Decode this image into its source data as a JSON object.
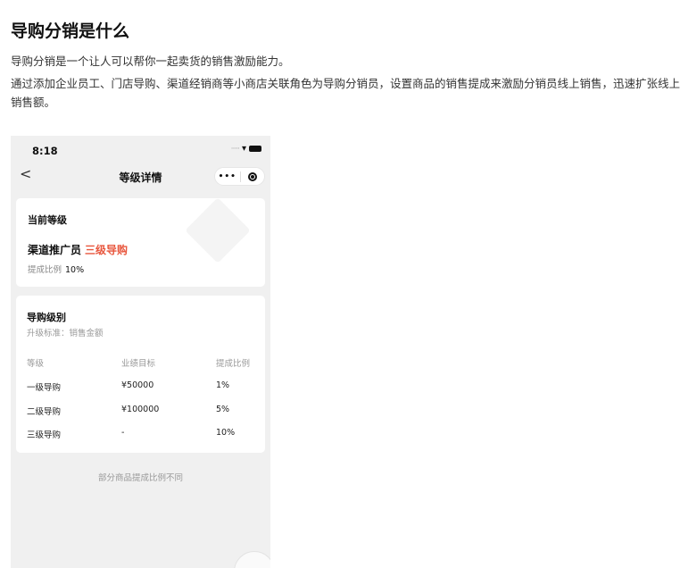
{
  "doc": {
    "title": "导购分销是什么",
    "paragraph1": "导购分销是一个让人可以帮你一起卖货的销售激励能力。",
    "paragraph2": "通过添加企业员工、门店导购、渠道经销商等小商店关联角色为导购分销员，设置商品的销售提成来激励分销员线上销售，迅速扩张线上销售额。"
  },
  "phone": {
    "status_time": "8:18",
    "nav_back": "<",
    "nav_title": "等级详情",
    "capsule_more": "•••",
    "current_level_card": {
      "heading": "当前等级",
      "role": "渠道推广员",
      "level": "三级导购",
      "rate_label": "提成比例",
      "rate_value": "10%"
    },
    "levels_card": {
      "heading": "导购级别",
      "upgrade_standard": "升级标准：销售金额",
      "columns": [
        "等级",
        "业绩目标",
        "提成比例"
      ],
      "rows": [
        [
          "一级导购",
          "¥50000",
          "1%"
        ],
        [
          "二级导购",
          "¥100000",
          "5%"
        ],
        [
          "三级导购",
          "-",
          "10%"
        ]
      ]
    },
    "footnote": "部分商品提成比例不同"
  },
  "icons": {
    "back": "chevron-left-icon",
    "more": "more-dots-icon",
    "close": "record-circle-icon",
    "wifi": "wifi-icon",
    "battery": "battery-icon",
    "signal": "signal-icon"
  },
  "colors": {
    "accent": "#e8573e",
    "phone_bg": "#f0f0f0",
    "card_bg": "#ffffff"
  }
}
